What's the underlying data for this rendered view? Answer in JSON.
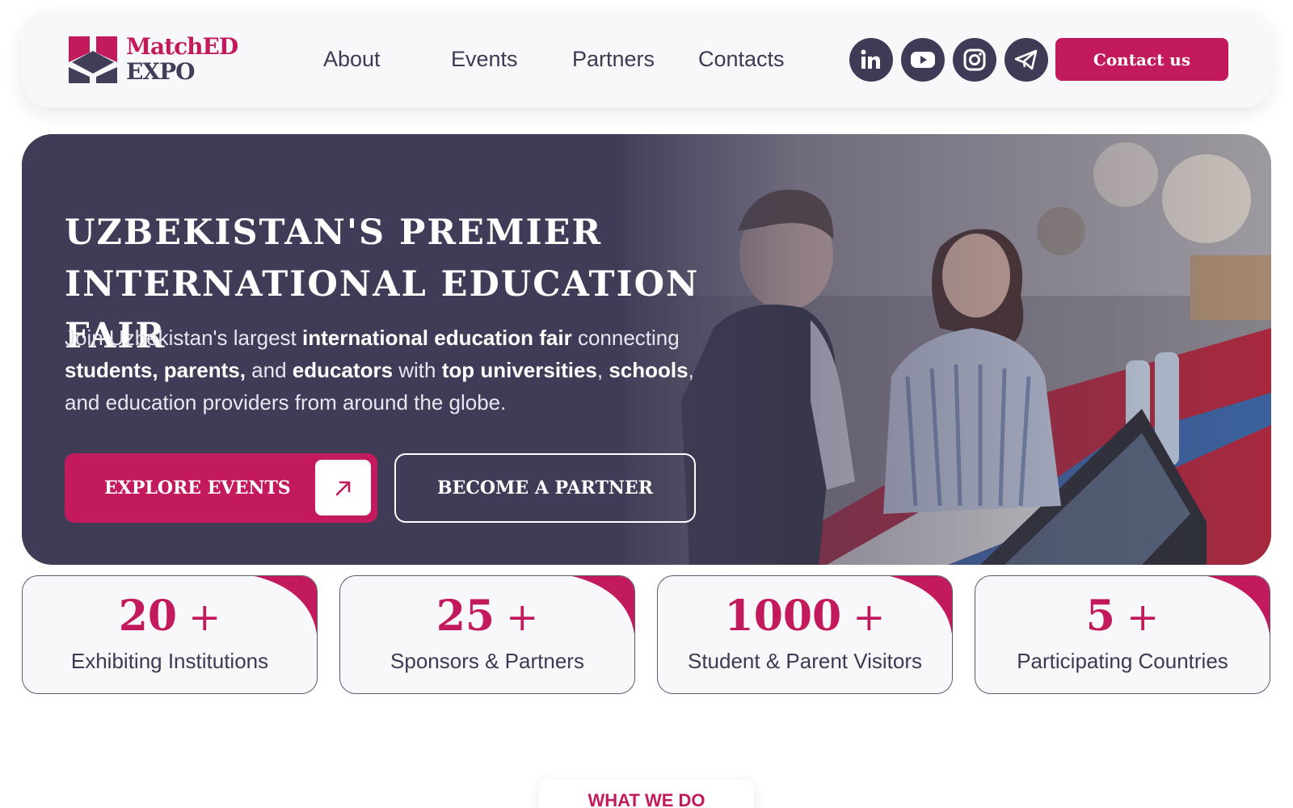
{
  "brand": {
    "line1": "MatchED",
    "line2": "EXPO",
    "primary_color": "#c21a5c",
    "dark_color": "#3f3b57",
    "logo_icon": "stacked-cube-logo-icon"
  },
  "nav": {
    "items": [
      "About",
      "Events",
      "Partners",
      "Contacts"
    ]
  },
  "social": [
    {
      "name": "linkedin-icon"
    },
    {
      "name": "youtube-icon"
    },
    {
      "name": "instagram-icon"
    },
    {
      "name": "telegram-icon"
    }
  ],
  "header": {
    "contact_label": "Contact us"
  },
  "hero": {
    "title_line1": "UZBEKISTAN'S PREMIER",
    "title_line2": "INTERNATIONAL EDUCATION FAIR",
    "text": {
      "t1": "Join Uzbekistan's largest ",
      "b1": "international education fair",
      "t2": " connecting ",
      "b2": "students, parents,",
      "t3": " and ",
      "b3": "educators",
      "t4": " with ",
      "b4": "top universities",
      "t5": ", ",
      "b5": "schools",
      "t6": ", and education providers from around the globe."
    },
    "explore_label": "EXPLORE EVENTS",
    "partner_label": "BECOME A PARTNER",
    "arrow_icon": "arrow-up-right-icon"
  },
  "stats": [
    {
      "value": "20",
      "suffix": "+",
      "label": "Exhibiting Institutions"
    },
    {
      "value": "25",
      "suffix": "+",
      "label": "Sponsors & Partners"
    },
    {
      "value": "1000",
      "suffix": "+",
      "label": "Student & Parent Visitors"
    },
    {
      "value": "5",
      "suffix": "+",
      "label": "Participating Countries"
    }
  ],
  "section": {
    "what_we_do": "WHAT WE DO"
  }
}
